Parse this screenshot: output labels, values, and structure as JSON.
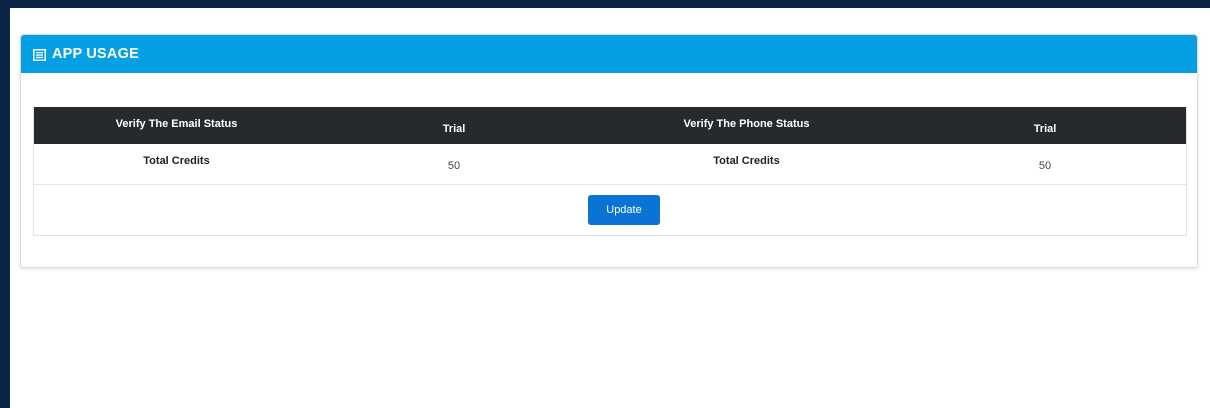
{
  "panel": {
    "title": "APP USAGE",
    "icon": "list-icon"
  },
  "table": {
    "headers": [
      "Verify The Email Status",
      "Trial",
      "Verify The Phone Status",
      "Trial"
    ],
    "rows": [
      [
        "Total Credits",
        "50",
        "Total Credits",
        "50"
      ]
    ]
  },
  "actions": {
    "update_label": "Update"
  },
  "colors": {
    "header_blue": "#059fe3",
    "table_header_dark": "#262a2d",
    "button_blue": "#0b72d6",
    "page_border_navy": "#0b2547"
  }
}
